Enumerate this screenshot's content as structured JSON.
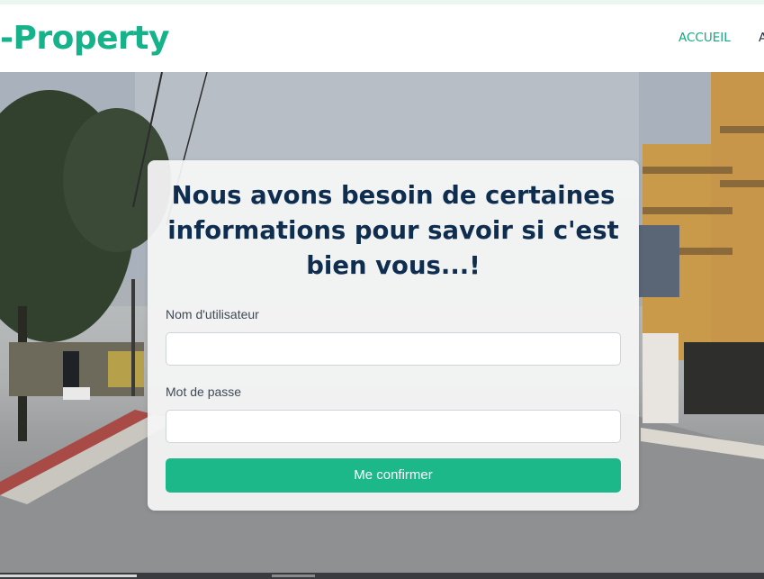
{
  "brand": {
    "name": "-Property"
  },
  "nav": {
    "items": [
      {
        "label": "ACCUEIL"
      },
      {
        "label": "A"
      }
    ]
  },
  "form": {
    "title": "Nous avons besoin de certaines informations pour savoir si c'est bien vous...!",
    "username_label": "Nom d'utilisateur",
    "username_value": "",
    "password_label": "Mot de passe",
    "password_value": "",
    "submit_label": "Me confirmer"
  },
  "colors": {
    "brand": "#16b38a",
    "button": "#1cb889",
    "title": "#0f2e4f"
  }
}
